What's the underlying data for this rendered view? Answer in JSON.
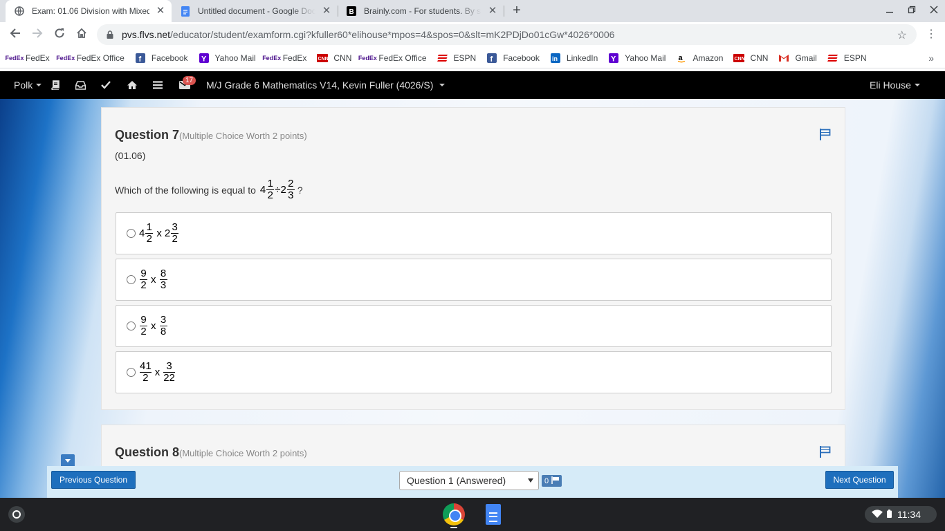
{
  "browser": {
    "tabs": [
      {
        "title": "Exam: 01.06 Division with Mixed Numbers",
        "icon": "globe-icon",
        "active": true
      },
      {
        "title": "Untitled document - Google Docs",
        "icon": "google-docs-icon",
        "active": false
      },
      {
        "title": "Brainly.com - For students. By students.",
        "icon": "brainly-icon",
        "active": false
      }
    ],
    "url_host": "pvs.flvs.net",
    "url_path": "/educator/student/examform.cgi?kfuller60*elihouse*mpos=4&spos=0&slt=mK2PDjDo01cGw*4026*0006",
    "bookmarks": [
      {
        "label": "FedEx",
        "icon": "fedex-icon"
      },
      {
        "label": "FedEx Office",
        "icon": "fedex-icon"
      },
      {
        "label": "Facebook",
        "icon": "facebook-icon"
      },
      {
        "label": "Yahoo Mail",
        "icon": "yahoo-icon"
      },
      {
        "label": "FedEx",
        "icon": "fedex-icon"
      },
      {
        "label": "CNN",
        "icon": "cnn-icon"
      },
      {
        "label": "FedEx Office",
        "icon": "fedex-icon"
      },
      {
        "label": "ESPN",
        "icon": "espn-icon"
      },
      {
        "label": "Facebook",
        "icon": "facebook-icon"
      },
      {
        "label": "LinkedIn",
        "icon": "linkedin-icon"
      },
      {
        "label": "Yahoo Mail",
        "icon": "yahoo-icon"
      },
      {
        "label": "Amazon",
        "icon": "amazon-icon"
      },
      {
        "label": "CNN",
        "icon": "cnn-icon"
      },
      {
        "label": "Gmail",
        "icon": "gmail-icon"
      },
      {
        "label": "ESPN",
        "icon": "espn-icon"
      }
    ],
    "bookmarks_more": "»"
  },
  "lms": {
    "school_menu": "Polk",
    "mail_count": "17",
    "course_title": "M/J Grade 6 Mathematics V14, Kevin Fuller (4026/S)",
    "user_name": "Eli House"
  },
  "exam": {
    "question7": {
      "title": "Question 7",
      "worth": "(Multiple Choice Worth 2 points)",
      "code": "(01.06)",
      "prompt": "Which of the following is equal to",
      "expr": {
        "a_whole": "4",
        "a_num": "1",
        "a_den": "2",
        "op": "÷",
        "b_whole": "2",
        "b_num": "2",
        "b_den": "3"
      },
      "end": "?",
      "options": [
        {
          "a_whole": "4",
          "a_num": "1",
          "a_den": "2",
          "op": "x",
          "b_whole": "2",
          "b_num": "3",
          "b_den": "2"
        },
        {
          "a_whole": "",
          "a_num": "9",
          "a_den": "2",
          "op": "x",
          "b_whole": "",
          "b_num": "8",
          "b_den": "3"
        },
        {
          "a_whole": "",
          "a_num": "9",
          "a_den": "2",
          "op": "x",
          "b_whole": "",
          "b_num": "3",
          "b_den": "8"
        },
        {
          "a_whole": "",
          "a_num": "41",
          "a_den": "2",
          "op": "x",
          "b_whole": "",
          "b_num": "3",
          "b_den": "22"
        }
      ]
    },
    "question8": {
      "title": "Question 8",
      "worth": "(Multiple Choice Worth 2 points)"
    }
  },
  "footer": {
    "prev_label": "Previous Question",
    "next_label": "Next Question",
    "selected_question": "Question 1 (Answered)",
    "flag_count": "0"
  },
  "shelf": {
    "time": "11:34"
  },
  "colors": {
    "accent": "#1e6fbd",
    "nav_bg": "#000000",
    "flag": "#2a6ebb",
    "badge": "#d9534f"
  }
}
